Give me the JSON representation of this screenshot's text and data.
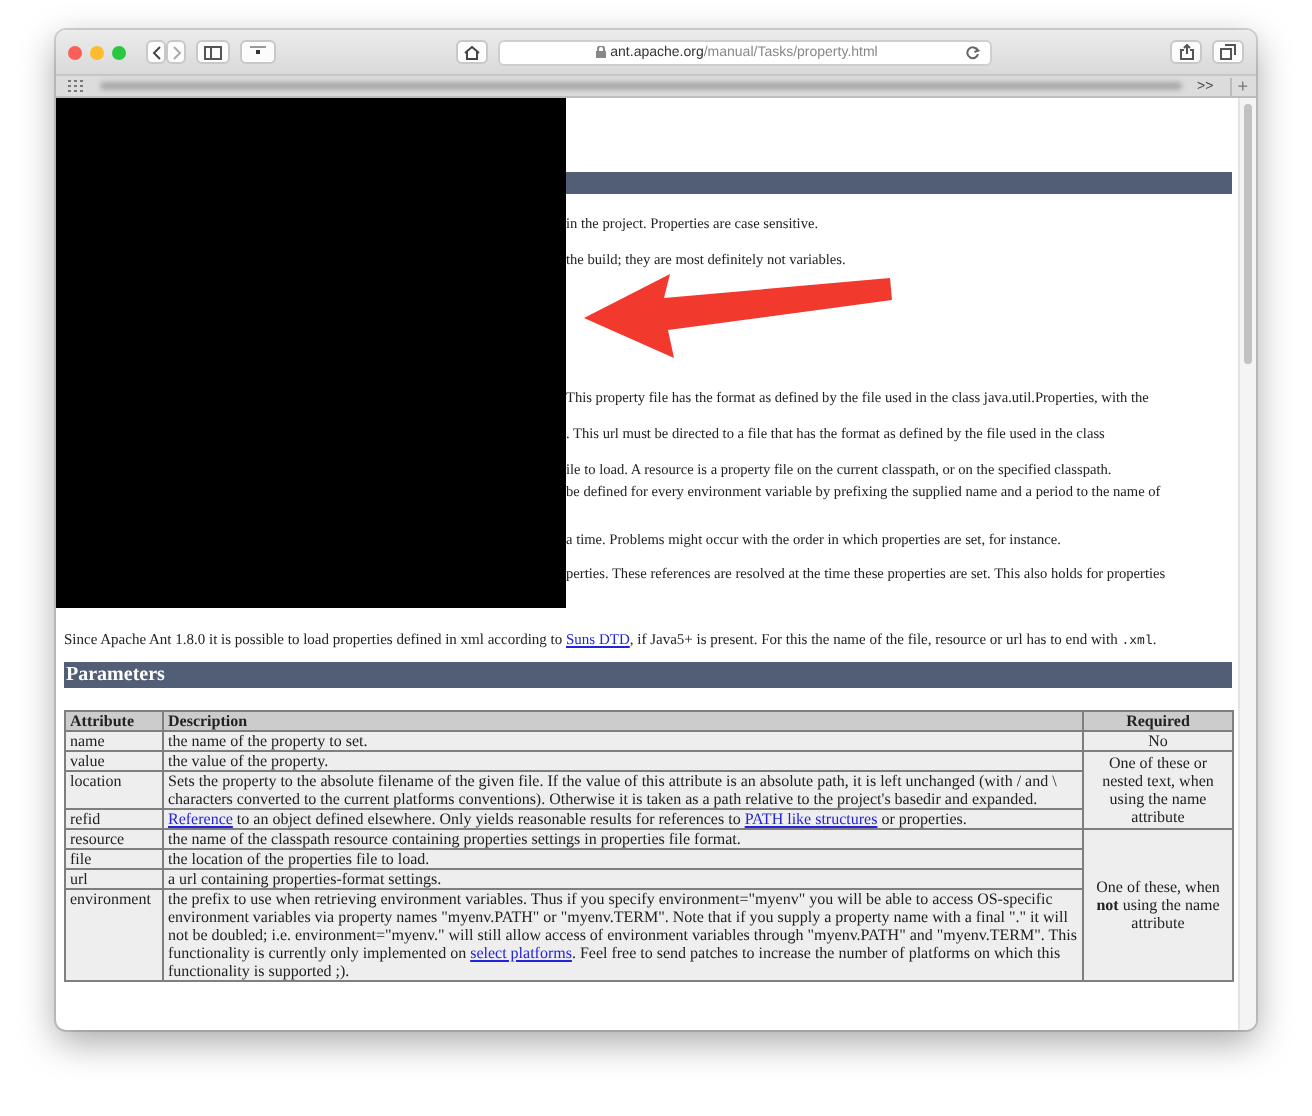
{
  "browser": {
    "url_domain": "ant.apache.org",
    "url_path": "/manual/Tasks/property.html",
    "overflow_label": ">>",
    "new_tab_label": "+"
  },
  "intro_fragments": [
    {
      "kind": "bar"
    },
    {
      "kind": "text",
      "text": "in the project. Properties are case sensitive."
    },
    {
      "kind": "text",
      "text": "the build; they are most definitely not variables."
    },
    {
      "kind": "text",
      "text": "This property file has the format as defined by the file used in the class java.util.Properties, with the"
    },
    {
      "kind": "text",
      "text": ". This url must be directed to a file that has the format as defined by the file used in the class"
    },
    {
      "kind": "text",
      "text": "ile to load. A resource is a property file on the current classpath, or on the specified classpath."
    },
    {
      "kind": "text",
      "text": "be defined for every environment variable by prefixing the supplied name and a period to the name of"
    },
    {
      "kind": "text",
      "text": "a time. Problems might occur with the order in which properties are set, for instance."
    },
    {
      "kind": "text",
      "text": "perties. These references are resolved at the time these properties are set. This also holds for properties"
    }
  ],
  "xml_note": [
    {
      "kind": "text",
      "text": "Since Apache Ant 1.8.0 it is possible to load properties defined in xml according to "
    },
    {
      "kind": "link",
      "text": "Suns DTD"
    },
    {
      "kind": "text",
      "text": ", if Java5+ is present. For this the name of the file, resource or url has to end with "
    },
    {
      "kind": "code",
      "text": ".xml"
    },
    {
      "kind": "text",
      "text": "."
    }
  ],
  "parameters": {
    "title": "Parameters",
    "columns": [
      "Attribute",
      "Description",
      "Required"
    ],
    "groups": [
      {
        "required": "No",
        "rows": [
          {
            "attribute": "name",
            "description": [
              {
                "kind": "text",
                "text": "the name of the property to set."
              }
            ]
          }
        ]
      },
      {
        "required": "One of these or nested text, when using the name attribute",
        "rows": [
          {
            "attribute": "value",
            "description": [
              {
                "kind": "text",
                "text": "the value of the property."
              }
            ]
          },
          {
            "attribute": "location",
            "description": [
              {
                "kind": "text",
                "text": "Sets the property to the absolute filename of the given file. If the value of this attribute is an absolute path, it is left unchanged (with / and \\ characters converted to the current platforms conventions). Otherwise it is taken as a path relative to the project's basedir and expanded."
              }
            ]
          },
          {
            "attribute": "refid",
            "description": [
              {
                "kind": "link",
                "text": "Reference"
              },
              {
                "kind": "text",
                "text": " to an object defined elsewhere. Only yields reasonable results for references to "
              },
              {
                "kind": "link",
                "text": "PATH like structures"
              },
              {
                "kind": "text",
                "text": " or properties."
              }
            ]
          }
        ]
      },
      {
        "required": "One of these, when **not** using the name attribute",
        "rows": [
          {
            "attribute": "resource",
            "description": [
              {
                "kind": "text",
                "text": "the name of the classpath resource containing properties settings in properties file format."
              }
            ]
          },
          {
            "attribute": "file",
            "description": [
              {
                "kind": "text",
                "text": "the location of the properties file to load."
              }
            ]
          },
          {
            "attribute": "url",
            "description": [
              {
                "kind": "text",
                "text": "a url containing properties-format settings."
              }
            ]
          },
          {
            "attribute": "environment",
            "description": [
              {
                "kind": "text",
                "text": "the prefix to use when retrieving environment variables. Thus if you specify environment=\"myenv\" you will be able to access OS-specific environment variables via property names \"myenv.PATH\" or \"myenv.TERM\". Note that if you supply a property name with a final \".\" it will not be doubled; i.e. environment=\"myenv.\" will still allow access of environment variables through \"myenv.PATH\" and \"myenv.TERM\". This functionality is currently only implemented on "
              },
              {
                "kind": "link",
                "text": "select platforms"
              },
              {
                "kind": "text",
                "text": ". Feel free to send patches to increase the number of platforms on which this functionality is supported ;)."
              }
            ]
          }
        ]
      }
    ]
  }
}
